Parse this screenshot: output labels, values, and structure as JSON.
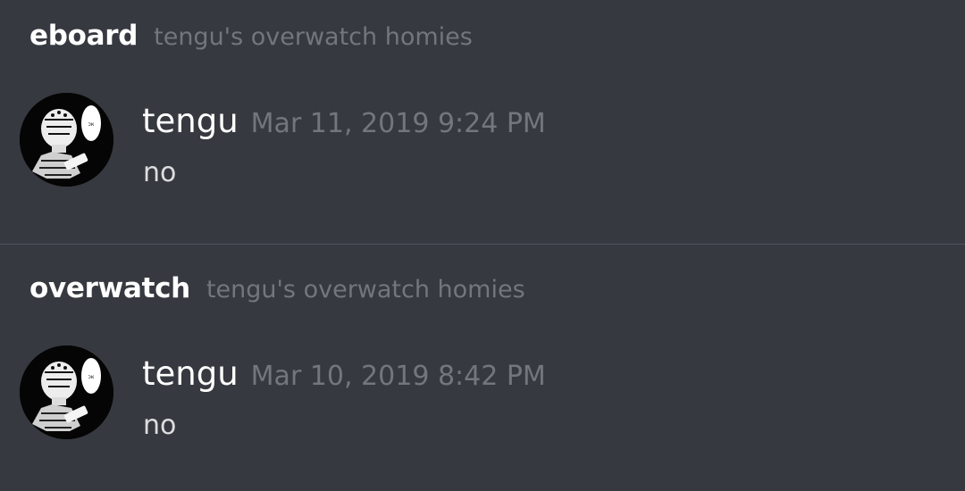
{
  "results": [
    {
      "channel": "eboard",
      "guild": "tengu's overwatch homies",
      "author": "tengu",
      "timestamp": "Mar 11, 2019 9:24 PM",
      "content": "no",
      "avatar_icon": "zenyatta-manga-avatar-icon"
    },
    {
      "channel": "overwatch",
      "guild": "tengu's overwatch homies",
      "author": "tengu",
      "timestamp": "Mar 10, 2019 8:42 PM",
      "content": "no",
      "avatar_icon": "zenyatta-manga-avatar-icon"
    }
  ],
  "colors": {
    "background": "#36393f",
    "divider": "#4f525a",
    "primary_text": "#ffffff",
    "muted_text": "#72767d",
    "message_text": "#dcddde"
  }
}
